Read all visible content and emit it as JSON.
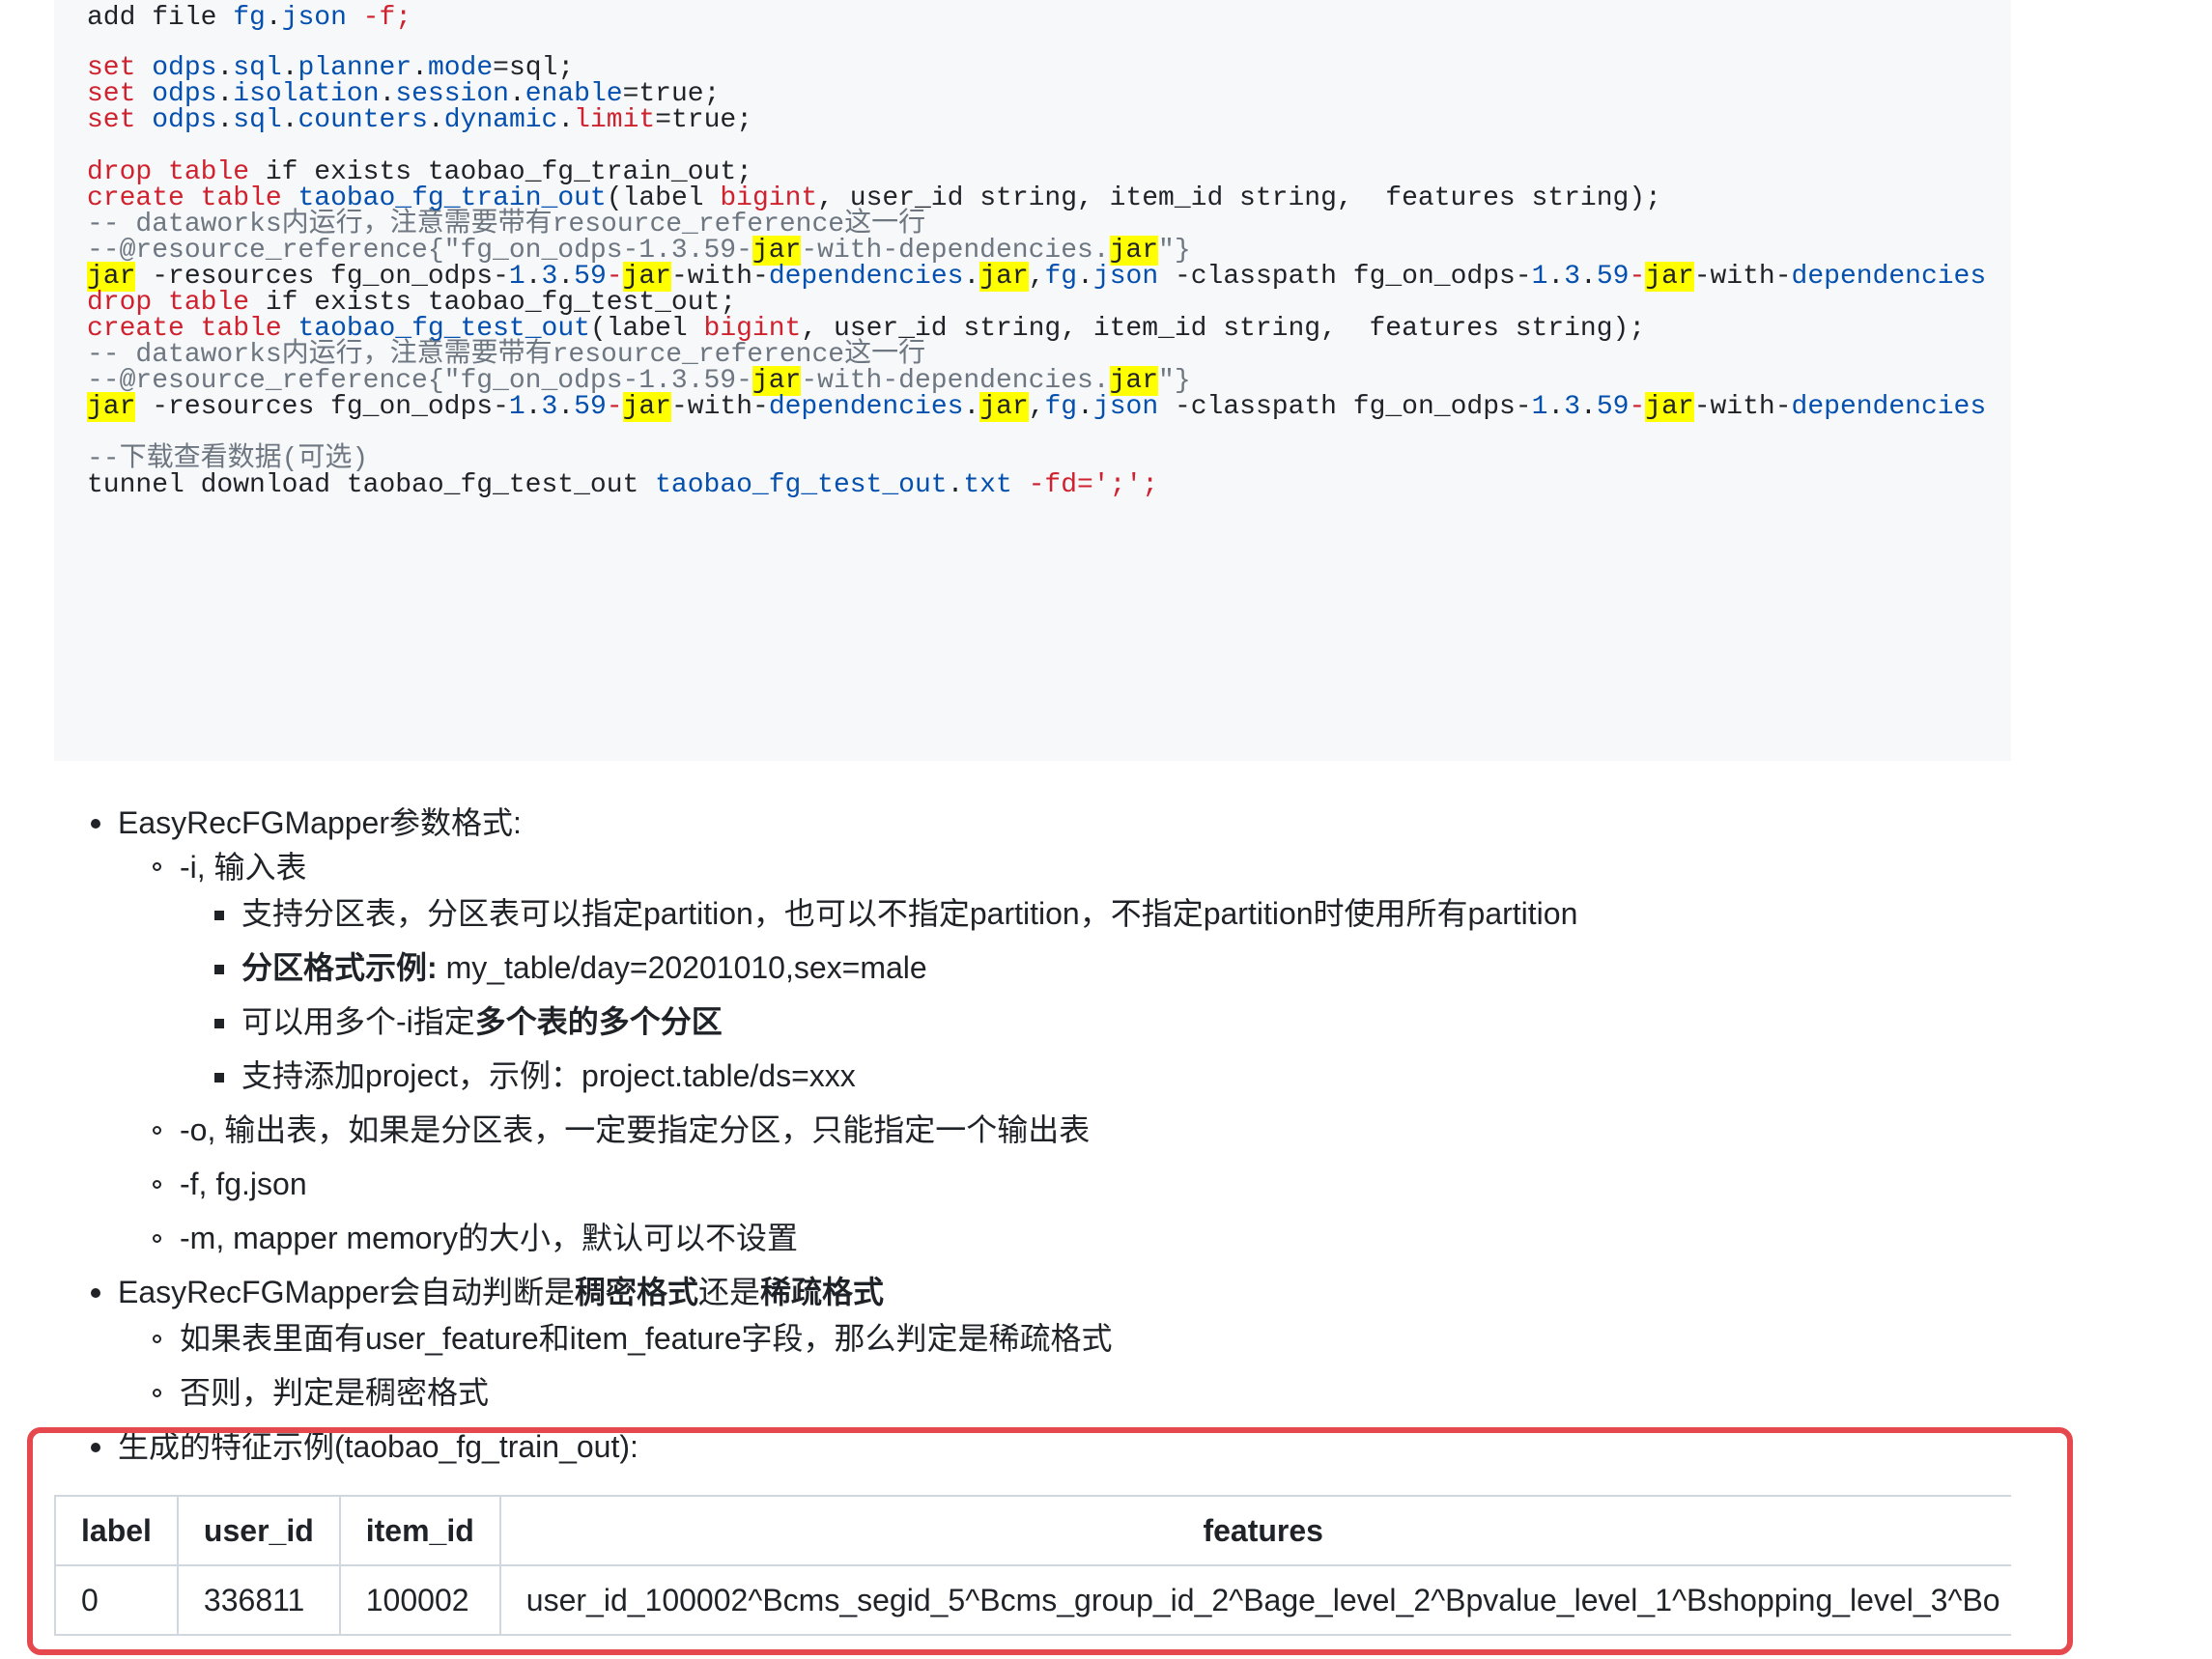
{
  "code": {
    "lines": [
      [
        "add file ",
        "fg",
        ".",
        "json",
        " -f;"
      ],
      [],
      [
        "set",
        " ",
        "odps",
        ".",
        "sql",
        ".",
        "planner",
        ".",
        "mode",
        "=sql;"
      ],
      [
        "set",
        " ",
        "odps",
        ".",
        "isolation",
        ".",
        "session",
        ".",
        "enable",
        "=true;"
      ],
      [
        "set",
        " ",
        "odps",
        ".",
        "sql",
        ".",
        "counters",
        ".",
        "dynamic",
        ".",
        "limit",
        "=true;"
      ],
      [],
      [
        "drop",
        " ",
        "table",
        " if exists taobao_fg_train_out;"
      ],
      [
        "create",
        " ",
        "table",
        " ",
        "taobao_fg_train_out",
        "(label ",
        "bigint",
        ", user_id string, item_id string,  features string);"
      ],
      [
        "-- dataworks内运行，注意需要带有resource_reference这一行"
      ],
      [
        "--@resource_reference{\"fg_on_odps-1.3.59-",
        "jar",
        "-with-dependencies.",
        "jar",
        "\"}"
      ],
      [
        "jar",
        " -resources fg_on_odps-",
        "1",
        ".",
        "3",
        ".",
        "59",
        "-",
        "jar",
        "-with-",
        "dependencies",
        ".",
        "jar",
        ",",
        "fg",
        ".",
        "json",
        " -classpath fg_on_odps-",
        "1",
        ".",
        "3",
        ".",
        "59",
        "-",
        "jar",
        "-with-",
        "dependencies"
      ],
      [
        "drop",
        " ",
        "table",
        " if exists taobao_fg_test_out;"
      ],
      [
        "create",
        " ",
        "table",
        " ",
        "taobao_fg_test_out",
        "(label ",
        "bigint",
        ", user_id string, item_id string,  features string);"
      ],
      [
        "-- dataworks内运行，注意需要带有resource_reference这一行"
      ],
      [
        "--@resource_reference{\"fg_on_odps-1.3.59-",
        "jar",
        "-with-dependencies.",
        "jar",
        "\"}"
      ],
      [
        "jar",
        " -resources fg_on_odps-",
        "1",
        ".",
        "3",
        ".",
        "59",
        "-",
        "jar",
        "-with-",
        "dependencies",
        ".",
        "jar",
        ",",
        "fg",
        ".",
        "json",
        " -classpath fg_on_odps-",
        "1",
        ".",
        "3",
        ".",
        "59",
        "-",
        "jar",
        "-with-",
        "dependencies"
      ],
      [],
      [
        "--下载查看数据(可选)"
      ],
      [
        "tunnel download taobao_fg_test_out ",
        "taobao_fg_test_out",
        ".",
        "txt",
        " -fd=';';"
      ]
    ]
  },
  "list": {
    "mapper_title": "EasyRecFGMapper参数格式:",
    "i_opt": "-i, 输入表",
    "i_sub1": "支持分区表，分区表可以指定partition，也可以不指定partition，不指定partition时使用所有partition",
    "i_sub2_bold": "分区格式示例:",
    "i_sub2_rest": " my_table/day=20201010,sex=male",
    "i_sub3_pre": "可以用多个-i指定",
    "i_sub3_bold": "多个表的多个分区",
    "i_sub4": "支持添加project，示例：project.table/ds=xxx",
    "o_opt": "-o, 输出表，如果是分区表，一定要指定分区，只能指定一个输出表",
    "f_opt": "-f, fg.json",
    "m_opt": "-m, mapper memory的大小，默认可以不设置",
    "auto_pre": "EasyRecFGMapper会自动判断是",
    "auto_b1": "稠密格式",
    "auto_mid": "还是",
    "auto_b2": "稀疏格式",
    "auto_sub1": "如果表里面有user_feature和item_feature字段，那么判定是稀疏格式",
    "auto_sub2": "否则，判定是稠密格式",
    "sample_title": "生成的特征示例(taobao_fg_train_out):"
  },
  "table": {
    "headers": [
      "label",
      "user_id",
      "item_id",
      "features"
    ],
    "row": [
      "0",
      "336811",
      "100002",
      "user_id_100002^Bcms_segid_5^Bcms_group_id_2^Bage_level_2^Bpvalue_level_1^Bshopping_level_3^Bo"
    ]
  },
  "colors": {
    "keyword": "#cf222e",
    "builtin": "#0550ae",
    "comment": "#6e7781",
    "highlight": "#ffff00",
    "annotation_box": "#e5484d"
  }
}
